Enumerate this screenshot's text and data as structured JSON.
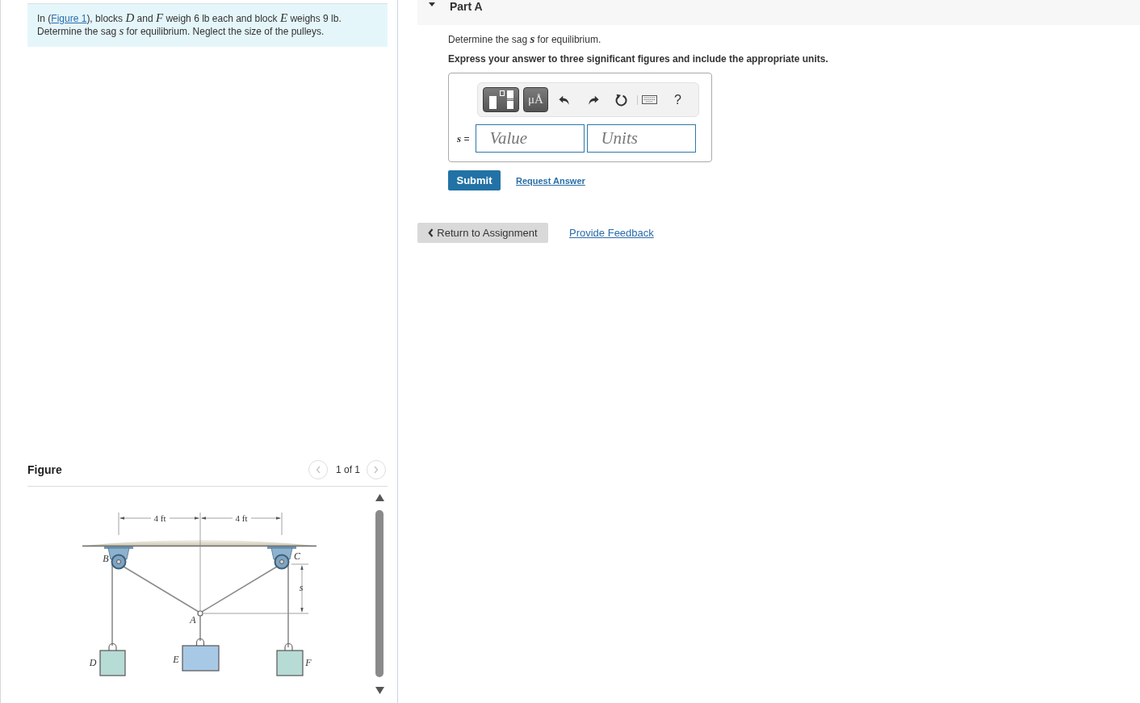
{
  "problem": {
    "before_link": "In (",
    "link": "Figure 1",
    "after_link": "), blocks *D* and *F* weigh 6 lb each and block *E* weighs 9 lb. Determine the sag *s* for equilibrium. Neglect the size of the pulleys."
  },
  "figure": {
    "title": "Figure",
    "pager": {
      "text": "1 of 1",
      "previous": {
        "disabled": true
      },
      "next": {
        "disabled": true
      }
    },
    "dimension_labels": [
      "4 ft",
      "4 ft"
    ],
    "point_labels": [
      "B",
      "C",
      "s",
      "A",
      "D",
      "E",
      "F"
    ]
  },
  "part": {
    "title": "Part A",
    "expanded": true,
    "question": "Determine the sag *s* for equilibrium.",
    "instruction": "Express your answer to three significant figures and include the appropriate units.",
    "toolbar": [
      {
        "kind": "templates"
      },
      {
        "kind": "symbols",
        "label": "μÅ"
      },
      {
        "kind": "undo"
      },
      {
        "kind": "redo"
      },
      {
        "kind": "reset"
      },
      {
        "kind": "keyboard"
      },
      {
        "kind": "help",
        "label": "?"
      }
    ],
    "answer_label": "*s* =",
    "value_field": {
      "placeholder": "Value"
    },
    "units_field": {
      "placeholder": "Units"
    },
    "submit": "Submit",
    "request_answer": "Request Answer"
  },
  "footer": {
    "return_button": "Return to Assignment",
    "feedback_link": "Provide Feedback"
  }
}
